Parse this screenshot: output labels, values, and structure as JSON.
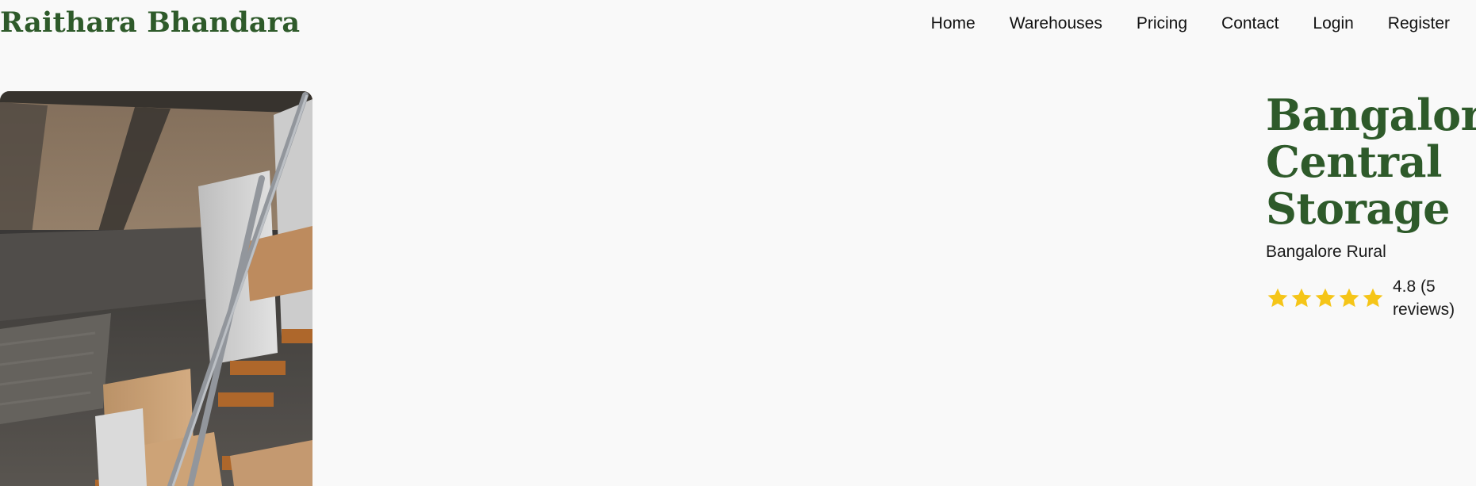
{
  "header": {
    "brand": "Raithara Bhandara",
    "nav": [
      "Home",
      "Warehouses",
      "Pricing",
      "Contact",
      "Login",
      "Register"
    ]
  },
  "listing": {
    "title": "Bangalore Central Storage",
    "location": "Bangalore Rural",
    "rating": 4.8,
    "rating_text": "4.8 (5 reviews)",
    "stars": 5,
    "star_color": "#f5c518"
  },
  "colors": {
    "brand": "#2e5a2a",
    "background": "#f9f9f9"
  },
  "icons": {
    "star": "star-icon"
  }
}
